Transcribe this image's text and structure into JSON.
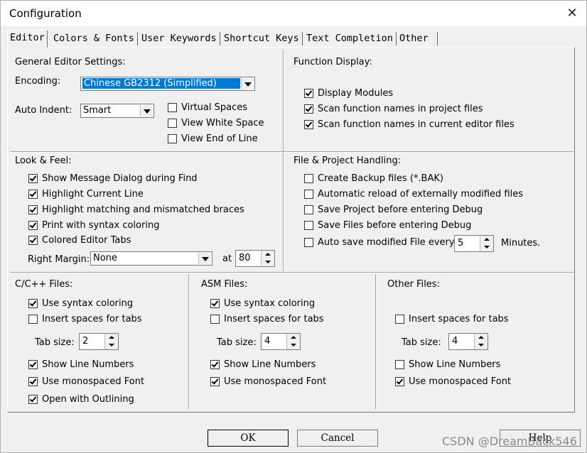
{
  "window": {
    "title": "Configuration",
    "close_glyph": "✕"
  },
  "tabs": [
    "Editor",
    "Colors & Fonts",
    "User Keywords",
    "Shortcut Keys",
    "Text Completion",
    "Other"
  ],
  "general": {
    "heading": "General Editor Settings:",
    "encoding_label": "Encoding:",
    "encoding_value": "Chinese GB2312 (Simplified)",
    "auto_indent_label": "Auto Indent:",
    "auto_indent_value": "Smart",
    "virtual_spaces": "Virtual Spaces",
    "view_white_space": "View White Space",
    "view_end_of_line": "View End of Line"
  },
  "function_display": {
    "heading": "Function Display:",
    "display_modules": "Display Modules",
    "scan_project": "Scan function names in project files",
    "scan_editor": "Scan function names in current editor files"
  },
  "look_feel": {
    "heading": "Look & Feel:",
    "show_message": "Show Message Dialog during Find",
    "highlight_line": "Highlight Current Line",
    "highlight_braces": "Highlight matching and mismatched braces",
    "print_syntax": "Print with syntax coloring",
    "colored_tabs": "Colored Editor Tabs",
    "right_margin_label": "Right Margin:",
    "right_margin_value": "None",
    "at_label": "at",
    "at_value": "80"
  },
  "file_project": {
    "heading": "File & Project Handling:",
    "create_backup": "Create Backup files (*.BAK)",
    "auto_reload": "Automatic reload of externally modified files",
    "save_project": "Save Project before entering Debug",
    "save_files": "Save Files before entering Debug",
    "auto_save": "Auto save modified File every",
    "auto_save_value": "5",
    "minutes": "Minutes."
  },
  "cpp": {
    "heading": "C/C++ Files:",
    "syntax": "Use syntax coloring",
    "spaces": "Insert spaces for tabs",
    "tab_size_label": "Tab size:",
    "tab_size": "2",
    "line_numbers": "Show Line Numbers",
    "monospaced": "Use monospaced Font",
    "outlining": "Open with Outlining"
  },
  "asm": {
    "heading": "ASM Files:",
    "syntax": "Use syntax coloring",
    "spaces": "Insert spaces for tabs",
    "tab_size_label": "Tab size:",
    "tab_size": "4",
    "line_numbers": "Show Line Numbers",
    "monospaced": "Use monospaced Font"
  },
  "other": {
    "heading": "Other Files:",
    "spaces": "Insert spaces for tabs",
    "tab_size_label": "Tab size:",
    "tab_size": "4",
    "line_numbers": "Show Line Numbers",
    "monospaced": "Use monospaced Font"
  },
  "buttons": {
    "ok": "OK",
    "cancel": "Cancel",
    "help": "Help"
  },
  "watermark": "CSDN @DreamBack546"
}
